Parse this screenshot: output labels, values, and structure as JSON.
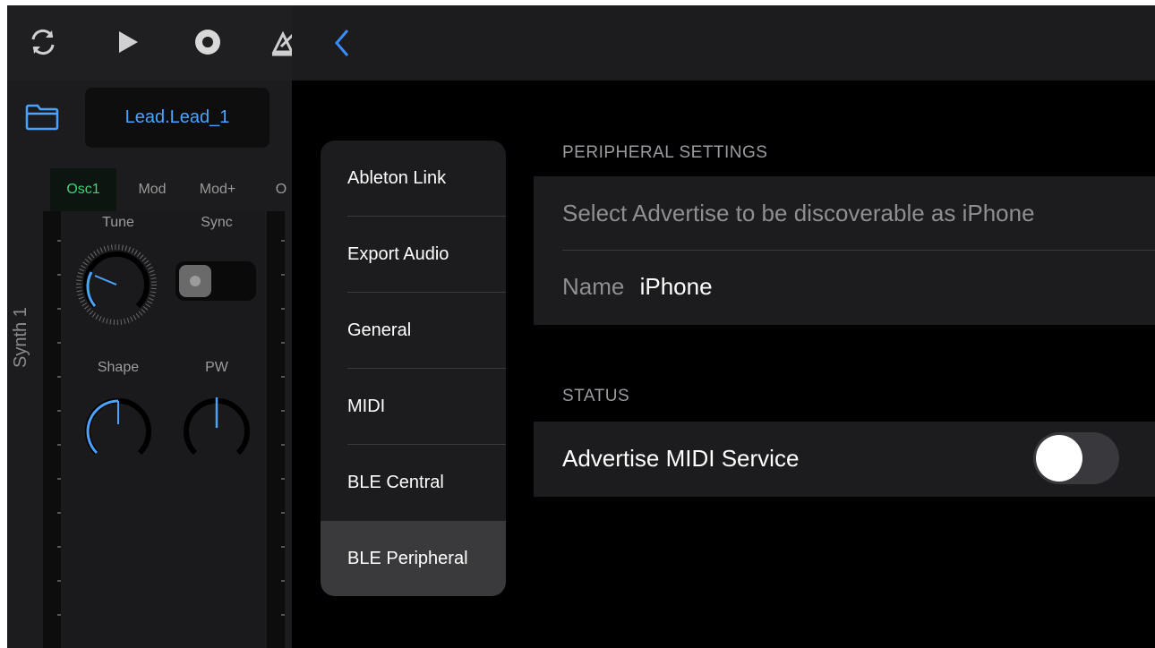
{
  "synth": {
    "preset_name": "Lead.Lead_1",
    "tabs": [
      {
        "label": "Osc1",
        "active": true
      },
      {
        "label": "Mod",
        "active": false
      },
      {
        "label": "Mod+",
        "active": false
      },
      {
        "label": "O",
        "active": false
      }
    ],
    "knobs": {
      "tune_label": "Tune",
      "sync_label": "Sync",
      "shape_label": "Shape",
      "pw_label": "PW"
    },
    "instrument_label": "Synth 1",
    "accent_color": "#4aa3ff",
    "active_tab_color": "#43d17a"
  },
  "toolbar": {
    "icons": [
      "loop-icon",
      "play-icon",
      "record-icon",
      "metronome-icon"
    ]
  },
  "settings_menu": {
    "items": [
      {
        "label": "Ableton Link"
      },
      {
        "label": "Export Audio"
      },
      {
        "label": "General"
      },
      {
        "label": "MIDI"
      },
      {
        "label": "BLE Central"
      },
      {
        "label": "BLE Peripheral",
        "selected": true
      }
    ]
  },
  "peripheral": {
    "header": "PERIPHERAL SETTINGS",
    "hint": "Select Advertise to be discoverable as iPhone",
    "name_label": "Name",
    "name_value": "iPhone"
  },
  "status": {
    "header": "STATUS",
    "advertise_label": "Advertise MIDI Service",
    "advertise_on": false
  }
}
